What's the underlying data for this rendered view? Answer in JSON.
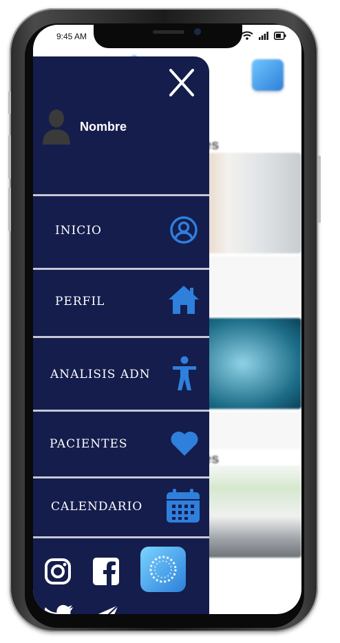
{
  "status_bar": {
    "time": "9:45 AM"
  },
  "background": {
    "title_fragment": "h",
    "section_1_fragment": "es",
    "section_2_fragment": "es"
  },
  "drawer": {
    "user_name": "Nombre",
    "menu": [
      {
        "label": "INICIO",
        "icon": "user-circle-icon"
      },
      {
        "label": "PERFIL",
        "icon": "home-icon"
      },
      {
        "label": "ANALISIS ADN",
        "icon": "person-icon"
      },
      {
        "label": "PACIENTES",
        "icon": "heart-icon"
      },
      {
        "label": "CALENDARIO",
        "icon": "calendar-icon"
      }
    ],
    "social": [
      "instagram-icon",
      "facebook-icon",
      "twitter-icon",
      "send-icon"
    ]
  },
  "colors": {
    "drawer_bg": "#141d4c",
    "icon_blue": "#2f7fdc",
    "divider": "#c5c9d6"
  }
}
